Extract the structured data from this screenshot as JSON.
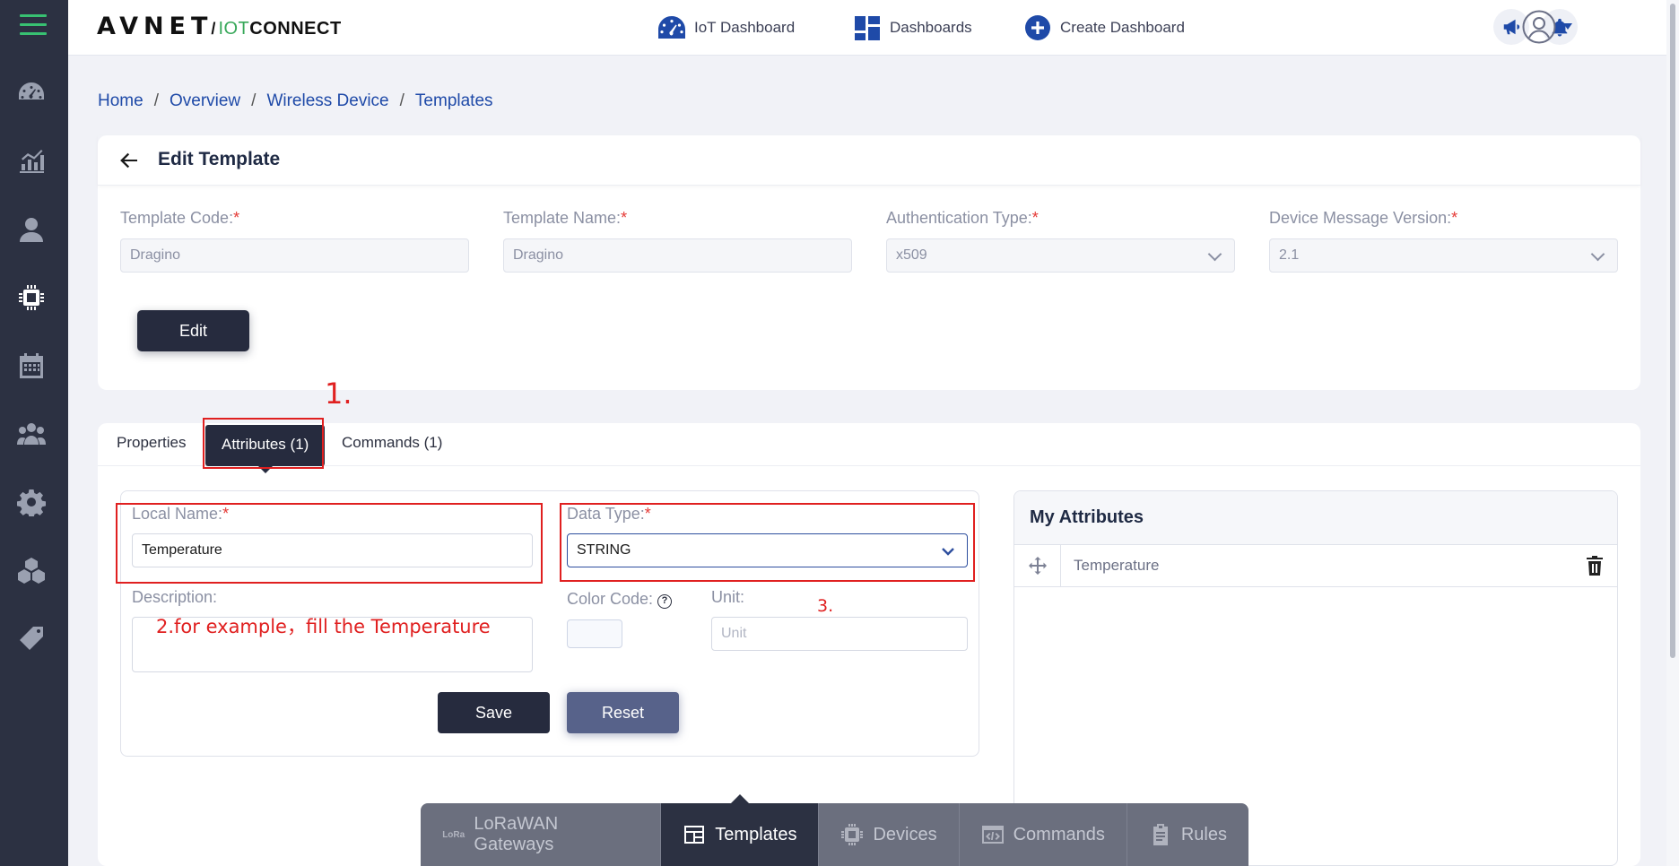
{
  "app": {
    "logo_avnet": "AVNET",
    "logo_slash": "/",
    "logo_iot": "IOT",
    "logo_connect": "CONNECT"
  },
  "header": {
    "nav": [
      {
        "label": "IoT Dashboard",
        "icon": "gauge-icon"
      },
      {
        "label": "Dashboards",
        "icon": "dashboard-grid-icon"
      },
      {
        "label": "Create Dashboard",
        "icon": "plus-circle-icon"
      }
    ],
    "icons": [
      "megaphone-icon",
      "bell-icon",
      "avatar-icon",
      "caret-down-icon"
    ]
  },
  "sidebar": {
    "items": [
      {
        "icon": "gauge-icon"
      },
      {
        "icon": "chart-icon"
      },
      {
        "icon": "user-icon"
      },
      {
        "icon": "chip-icon",
        "active": true
      },
      {
        "icon": "calendar-icon"
      },
      {
        "icon": "users-icon"
      },
      {
        "icon": "gear-icon"
      },
      {
        "icon": "cubes-icon"
      },
      {
        "icon": "tag-icon"
      }
    ]
  },
  "breadcrumb": {
    "items": [
      "Home",
      "Overview",
      "Wireless Device",
      "Templates"
    ],
    "separator": "/"
  },
  "edit_template": {
    "title": "Edit Template",
    "fields": [
      {
        "label": "Template Code:",
        "value": "Dragino"
      },
      {
        "label": "Template Name:",
        "value": "Dragino"
      },
      {
        "label": "Authentication Type:",
        "value": "x509"
      },
      {
        "label": "Device Message Version:",
        "value": "2.1"
      }
    ],
    "required_mark": "*",
    "edit_button": "Edit"
  },
  "tabs": [
    {
      "label": "Properties"
    },
    {
      "label": "Attributes (1)",
      "active": true
    },
    {
      "label": "Commands (1)"
    }
  ],
  "attribute_form": {
    "local_name_label": "Local Name:",
    "local_name_value": "Temperature",
    "data_type_label": "Data Type:",
    "data_type_value": "STRING",
    "description_label": "Description:",
    "description_value": "",
    "color_code_label": "Color Code:",
    "help_glyph": "?",
    "unit_label": "Unit:",
    "unit_placeholder": "Unit",
    "save_button": "Save",
    "reset_button": "Reset"
  },
  "my_attributes": {
    "title": "My Attributes",
    "items": [
      "Temperature"
    ]
  },
  "annotations": {
    "step1": "1.",
    "step2": "2.for example，fill the Temperature",
    "step3": "3.",
    "color": "#e02020"
  },
  "bottom_nav": [
    {
      "label": "LoRaWAN Gateways",
      "icon": "lora-icon",
      "icon_text": "LoRa"
    },
    {
      "label": "Templates",
      "icon": "template-icon",
      "active": true
    },
    {
      "label": "Devices",
      "icon": "chip-icon"
    },
    {
      "label": "Commands",
      "icon": "code-window-icon"
    },
    {
      "label": "Rules",
      "icon": "clipboard-icon"
    }
  ],
  "colors": {
    "sidebar_bg": "#2c3142",
    "accent_blue": "#1f4aa8",
    "dark_button": "#262b3e",
    "reset_button": "#57628a",
    "brand_green": "#38a85a"
  }
}
